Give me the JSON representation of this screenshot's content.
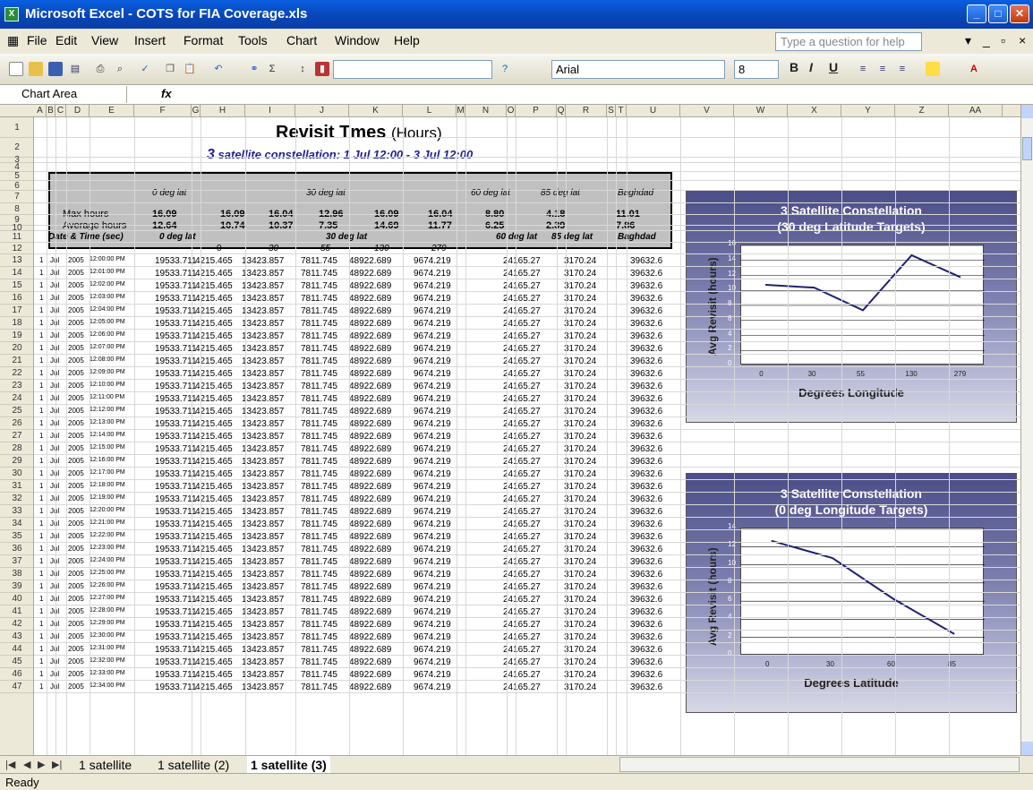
{
  "window": {
    "title": "Microsoft Excel - COTS for FIA Coverage.xls"
  },
  "menu": [
    "File",
    "Edit",
    "View",
    "Insert",
    "Format",
    "Tools",
    "Chart",
    "Window",
    "Help"
  ],
  "help_placeholder": "Type a question for help",
  "toolbar": {
    "font": "Arial",
    "size": "8",
    "bold": "B",
    "italic": "I",
    "underline": "U"
  },
  "namebox": "Chart Area",
  "fx": "fx",
  "columns": [
    "A",
    "B",
    "C",
    "D",
    "E",
    "F",
    "G",
    "H",
    "I",
    "J",
    "K",
    "L",
    "M",
    "N",
    "O",
    "P",
    "Q",
    "R",
    "S",
    "T",
    "U",
    "V",
    "W",
    "X",
    "Y",
    "Z",
    "AA"
  ],
  "sheet": {
    "title": "Revisit Tmes",
    "title_unit": "(Hours)",
    "subtitle_num": "3",
    "subtitle": "satellite constellation: 1 Jul 12:00 - 3 Jul 12:00",
    "summary": {
      "headers": [
        "0 deg lat",
        "30 deg lat",
        "60 deg lat",
        "85 deg lat",
        "Baghdad"
      ],
      "max_label": "Max hours",
      "avg_label": "Average hours",
      "max": [
        "16.09",
        "16.09",
        "16.04",
        "12.96",
        "16.09",
        "16.04",
        "8.80",
        "4.18",
        "11.01"
      ],
      "avg": [
        "12.64",
        "10.74",
        "10.37",
        "7.35",
        "14.69",
        "11.77",
        "6.25",
        "2.39",
        "7.86"
      ]
    },
    "table_headers": {
      "datetime": "Date & Time (sec)",
      "lat0": "0 deg lat",
      "lat30": "30 deg lat",
      "lat60": "60 deg lat",
      "lat85": "85 deg lat",
      "baghdad": "Baghdad"
    },
    "lon_headers": [
      "0",
      "30",
      "55",
      "130",
      "279"
    ],
    "row_values": {
      "day": "1",
      "month": "Jul",
      "year": "2005",
      "v0": "19533.711",
      "v30": [
        "4215.465",
        "13423.857",
        "7811.745",
        "48922.689",
        "9674.219"
      ],
      "v60": "24165.27",
      "v85": "3170.24",
      "vb": "39632.6"
    },
    "times": [
      "12:00:00 PM",
      "12:01:00 PM",
      "12:02:00 PM",
      "12:03:00 PM",
      "12:04:00 PM",
      "12:05:00 PM",
      "12:06:00 PM",
      "12:07:00 PM",
      "12:08:00 PM",
      "12:09:00 PM",
      "12:10:00 PM",
      "12:11:00 PM",
      "12:12:00 PM",
      "12:13:00 PM",
      "12:14:00 PM",
      "12:15:00 PM",
      "12:16:00 PM",
      "12:17:00 PM",
      "12:18:00 PM",
      "12:19:00 PM",
      "12:20:00 PM",
      "12:21:00 PM",
      "12:22:00 PM",
      "12:23:00 PM",
      "12:24:00 PM",
      "12:25:00 PM",
      "12:26:00 PM",
      "12:27:00 PM",
      "12:28:00 PM",
      "12:29:00 PM",
      "12:30:00 PM",
      "12:31:00 PM",
      "12:32:00 PM",
      "12:33:00 PM",
      "12:34:00 PM"
    ],
    "row_numbers": [
      "1",
      "2",
      "3",
      "4",
      "5",
      "6",
      "7",
      "8",
      "9",
      "10",
      "11",
      "12",
      "13",
      "14",
      "15",
      "16",
      "17",
      "18",
      "19",
      "20",
      "21",
      "22",
      "23",
      "24",
      "25",
      "26",
      "27",
      "28",
      "29",
      "30",
      "31",
      "32",
      "33",
      "34",
      "35",
      "36",
      "37",
      "38",
      "39",
      "40",
      "41",
      "42",
      "43",
      "44",
      "45",
      "46",
      "47"
    ]
  },
  "chart_data": [
    {
      "type": "line",
      "title": "3 Satellite Constellation",
      "subtitle": "(30 deg Latitude Targets)",
      "xlabel": "Degrees Longitude",
      "ylabel": "Avg Revisit (hours)",
      "categories": [
        "0",
        "30",
        "55",
        "130",
        "279"
      ],
      "values": [
        10.74,
        10.37,
        7.35,
        14.69,
        11.77
      ],
      "ylim": [
        0,
        16
      ],
      "yticks": [
        "0",
        "2",
        "4",
        "6",
        "8",
        "10",
        "12",
        "14",
        "16"
      ],
      "grid": true,
      "line_color": "#1f1f6f"
    },
    {
      "type": "line",
      "title": "3 Satellite Constellation",
      "subtitle": "(0 deg Longitude Targets)",
      "xlabel": "Degrees Latitude",
      "ylabel": "Avg Revisit (hours)",
      "categories": [
        "0",
        "30",
        "60",
        "85"
      ],
      "values": [
        12.64,
        10.74,
        6.25,
        2.39
      ],
      "ylim": [
        0,
        14
      ],
      "yticks": [
        "0",
        "2",
        "4",
        "6",
        "8",
        "10",
        "12",
        "14"
      ],
      "grid": true,
      "line_color": "#1f1f6f"
    }
  ],
  "tabs": [
    "1 satellite",
    "1 satellite (2)",
    "1 satellite (3)"
  ],
  "status": "Ready"
}
